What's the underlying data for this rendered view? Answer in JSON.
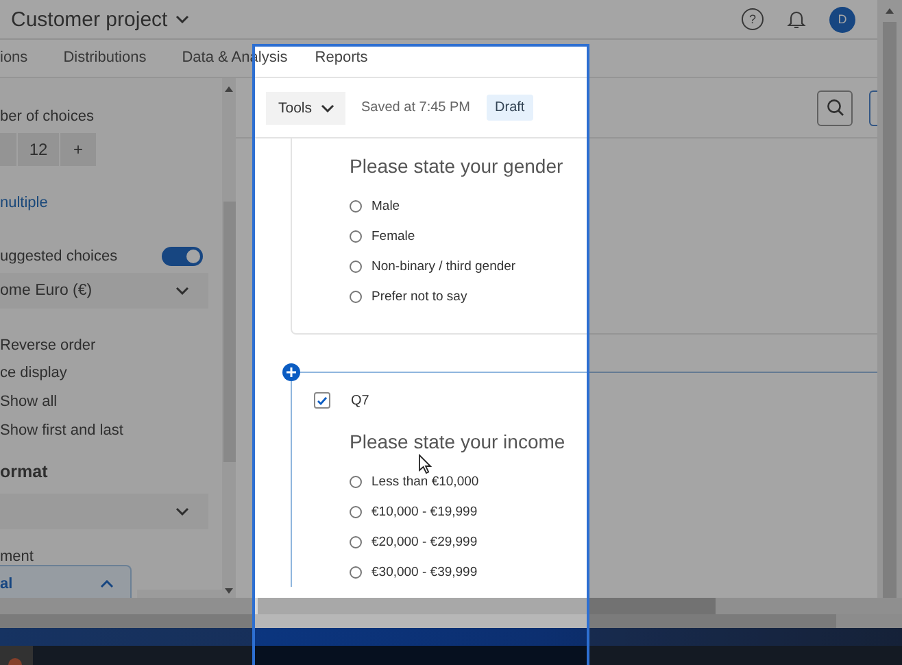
{
  "header": {
    "project": "Customer project",
    "help": "?",
    "avatar": "D"
  },
  "tabs": [
    {
      "label": "ions",
      "selected": false
    },
    {
      "label": "Distributions",
      "selected": false
    },
    {
      "label": "Data & Analysis",
      "selected": false
    },
    {
      "label": "Reports",
      "selected": false
    }
  ],
  "side_panel": [
    {
      "kind": "label",
      "text": "ber of choices"
    },
    {
      "kind": "stepper",
      "value": "12",
      "plus": "+"
    },
    {
      "kind": "link",
      "text": "nultiple"
    },
    {
      "kind": "toggle",
      "text": "uggested choices",
      "on": true
    },
    {
      "kind": "dropdown",
      "text": "ome Euro (€)"
    },
    {
      "kind": "text",
      "text": "Reverse order"
    },
    {
      "kind": "label",
      "text": "ce display"
    },
    {
      "kind": "text",
      "text": "Show all"
    },
    {
      "kind": "text",
      "text": "Show first and last"
    },
    {
      "kind": "heading",
      "text": "ormat"
    },
    {
      "kind": "dropdown"
    },
    {
      "kind": "label",
      "text": "ment"
    },
    {
      "kind": "open-dropdown",
      "text": "al"
    }
  ],
  "toolbar": {
    "tools": "Tools",
    "saved": "Saved at 7:45 PM",
    "status": "Draft"
  },
  "questions": [
    {
      "text": "Please state your gender",
      "choices": [
        {
          "label": "Male",
          "selected": false
        },
        {
          "label": "Female",
          "selected": false
        },
        {
          "label": "Non-binary / third gender",
          "selected": false
        },
        {
          "label": "Prefer not to say",
          "selected": false
        }
      ]
    },
    {
      "number": "Q7",
      "checked": true,
      "text": "Please state your income",
      "choices": [
        {
          "label": "Less than €10,000",
          "selected": false
        },
        {
          "label": "€10,000 - €19,999",
          "selected": false
        },
        {
          "label": "€20,000 - €29,999",
          "selected": false
        },
        {
          "label": "€30,000 - €39,999",
          "selected": false
        }
      ]
    }
  ]
}
